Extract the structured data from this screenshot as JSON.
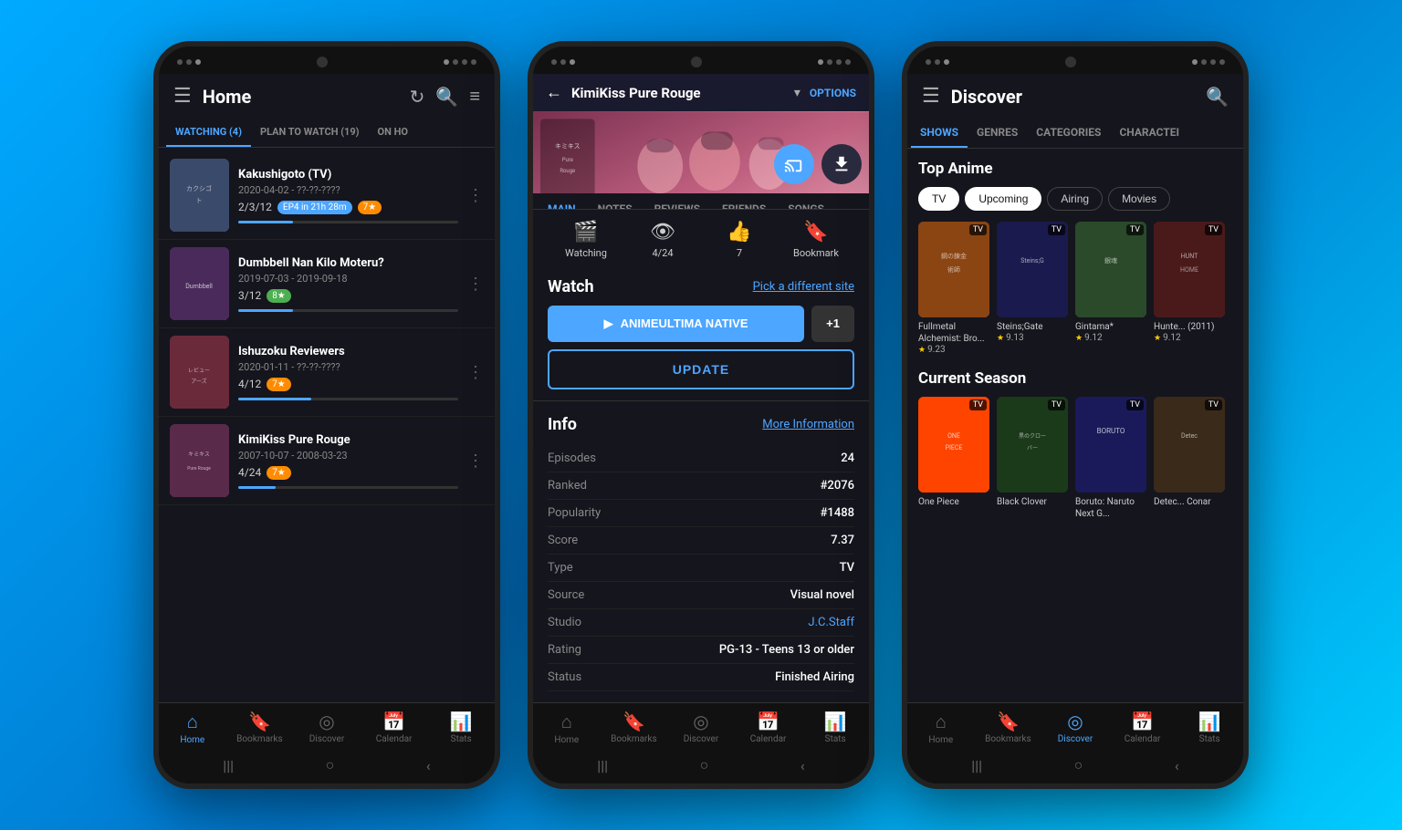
{
  "background": "#0099dd",
  "phones": [
    {
      "id": "home",
      "header": {
        "menu_icon": "☰",
        "title": "Home",
        "refresh_icon": "↻",
        "search_icon": "🔍",
        "filter_icon": "≡"
      },
      "tabs": [
        {
          "label": "WATCHING (4)",
          "active": true
        },
        {
          "label": "PLAN TO WATCH (19)",
          "active": false
        },
        {
          "label": "ON HO",
          "active": false
        }
      ],
      "anime_list": [
        {
          "title": "Kakushigoto (TV)",
          "dates": "2020-04-02 - ??-??-????",
          "progress": "2/3/12",
          "badge_ep": "EP4 in 21h 28m",
          "badge_score": "7★",
          "badge_type": "orange",
          "progress_pct": 25,
          "progress_color": "#4da6ff",
          "cover_class": "cover-kakushi"
        },
        {
          "title": "Dumbbell Nan Kilo Moteru?",
          "dates": "2019-07-03 - 2019-09-18",
          "progress": "3/12",
          "badge_ep": null,
          "badge_score": "8★",
          "badge_type": "green",
          "progress_pct": 25,
          "progress_color": "#4da6ff",
          "cover_class": "cover-dumbbell"
        },
        {
          "title": "Ishuzoku Reviewers",
          "dates": "2020-01-11 - ??-??-????",
          "progress": "4/12",
          "badge_ep": null,
          "badge_score": "7★",
          "badge_type": "orange",
          "progress_pct": 33,
          "progress_color": "#4da6ff",
          "cover_class": "cover-ishuzoku"
        },
        {
          "title": "KimiKiss Pure Rouge",
          "dates": "2007-10-07 - 2008-03-23",
          "progress": "4/24",
          "badge_ep": null,
          "badge_score": "7★",
          "badge_type": "orange",
          "progress_pct": 17,
          "progress_color": "#4da6ff",
          "cover_class": "cover-kimikiss-sm"
        }
      ],
      "bottom_nav": [
        {
          "icon": "🏠",
          "label": "Home",
          "active": true
        },
        {
          "icon": "🔖",
          "label": "Bookmarks",
          "active": false
        },
        {
          "icon": "🌐",
          "label": "Discover",
          "active": false
        },
        {
          "icon": "📅",
          "label": "Calendar",
          "active": false
        },
        {
          "icon": "📊",
          "label": "Stats",
          "active": false
        }
      ]
    },
    {
      "id": "detail",
      "title": "KimiKiss Pure Rouge",
      "options_label": "OPTIONS",
      "back_icon": "←",
      "tabs": [
        "MAIN",
        "NOTES",
        "REVIEWS",
        "FRIENDS",
        "SONGS"
      ],
      "active_tab": "MAIN",
      "actions": [
        {
          "icon": "🎬",
          "label": "Watching",
          "sub": null
        },
        {
          "icon": "👁",
          "label": "4/24",
          "sub": null
        },
        {
          "icon": "👍",
          "label": "7",
          "sub": null
        },
        {
          "icon": "🔖",
          "label": "Bookmark",
          "sub": null
        }
      ],
      "watch": {
        "title": "Watch",
        "pick_site": "Pick a different site",
        "primary_btn": "ANIMEULTIMA NATIVE",
        "more_btn": "+1",
        "update_btn": "UPDATE"
      },
      "info": {
        "title": "Info",
        "more_link": "More Information",
        "rows": [
          {
            "label": "Episodes",
            "value": "24",
            "link": false
          },
          {
            "label": "Ranked",
            "value": "#2076",
            "link": false
          },
          {
            "label": "Popularity",
            "value": "#1488",
            "link": false
          },
          {
            "label": "Score",
            "value": "7.37",
            "link": false
          },
          {
            "label": "Type",
            "value": "TV",
            "link": false
          },
          {
            "label": "Source",
            "value": "Visual novel",
            "link": false
          },
          {
            "label": "Studio",
            "value": "J.C.Staff",
            "link": true
          },
          {
            "label": "Rating",
            "value": "PG-13 - Teens 13 or older",
            "link": false
          },
          {
            "label": "Status",
            "value": "Finished Airing",
            "link": false
          }
        ]
      },
      "bottom_nav": [
        {
          "icon": "🏠",
          "label": "Home",
          "active": false
        },
        {
          "icon": "🔖",
          "label": "Bookmarks",
          "active": false
        },
        {
          "icon": "🌐",
          "label": "Discover",
          "active": false
        },
        {
          "icon": "📅",
          "label": "Calendar",
          "active": false
        },
        {
          "icon": "📊",
          "label": "Stats",
          "active": false
        }
      ]
    },
    {
      "id": "discover",
      "title": "Discover",
      "search_icon": "🔍",
      "tabs": [
        "SHOWS",
        "GENRES",
        "CATEGORIES",
        "CHARACTEI"
      ],
      "active_tab": "SHOWS",
      "filter_pills": [
        {
          "label": "TV",
          "active": true
        },
        {
          "label": "Upcoming",
          "active": true
        },
        {
          "label": "Airing",
          "active": false
        },
        {
          "label": "Movies",
          "active": false
        }
      ],
      "top_anime_title": "Top Anime",
      "top_anime": [
        {
          "title": "Fullmetal Alchemist: Bro...",
          "score": "9.23",
          "badge": "TV",
          "cover_class": "cover-fma"
        },
        {
          "title": "Steins;Gate",
          "score": "9.13",
          "badge": "TV",
          "cover_class": "cover-steins"
        },
        {
          "title": "Gintama*",
          "score": "9.12",
          "badge": "TV",
          "cover_class": "cover-gintama"
        },
        {
          "title": "Hunte... (2011)",
          "score": "9.12",
          "badge": "TV",
          "cover_class": "cover-hunt"
        }
      ],
      "current_season_title": "Current Season",
      "current_season": [
        {
          "title": "One Piece",
          "score": null,
          "badge": "TV",
          "cover_class": "cover-op"
        },
        {
          "title": "Black Clover",
          "score": null,
          "badge": "TV",
          "cover_class": "cover-bc"
        },
        {
          "title": "Boruto: Naruto Next G...",
          "score": null,
          "badge": "TV",
          "cover_class": "cover-boruto"
        },
        {
          "title": "Detec... Conar",
          "score": null,
          "badge": "TV",
          "cover_class": "cover-det"
        }
      ],
      "bottom_nav": [
        {
          "icon": "🏠",
          "label": "Home",
          "active": false
        },
        {
          "icon": "🔖",
          "label": "Bookmarks",
          "active": false
        },
        {
          "icon": "🌐",
          "label": "Discover",
          "active": true
        },
        {
          "icon": "📅",
          "label": "Calendar",
          "active": false
        },
        {
          "icon": "📊",
          "label": "Stats",
          "active": false
        }
      ]
    }
  ]
}
